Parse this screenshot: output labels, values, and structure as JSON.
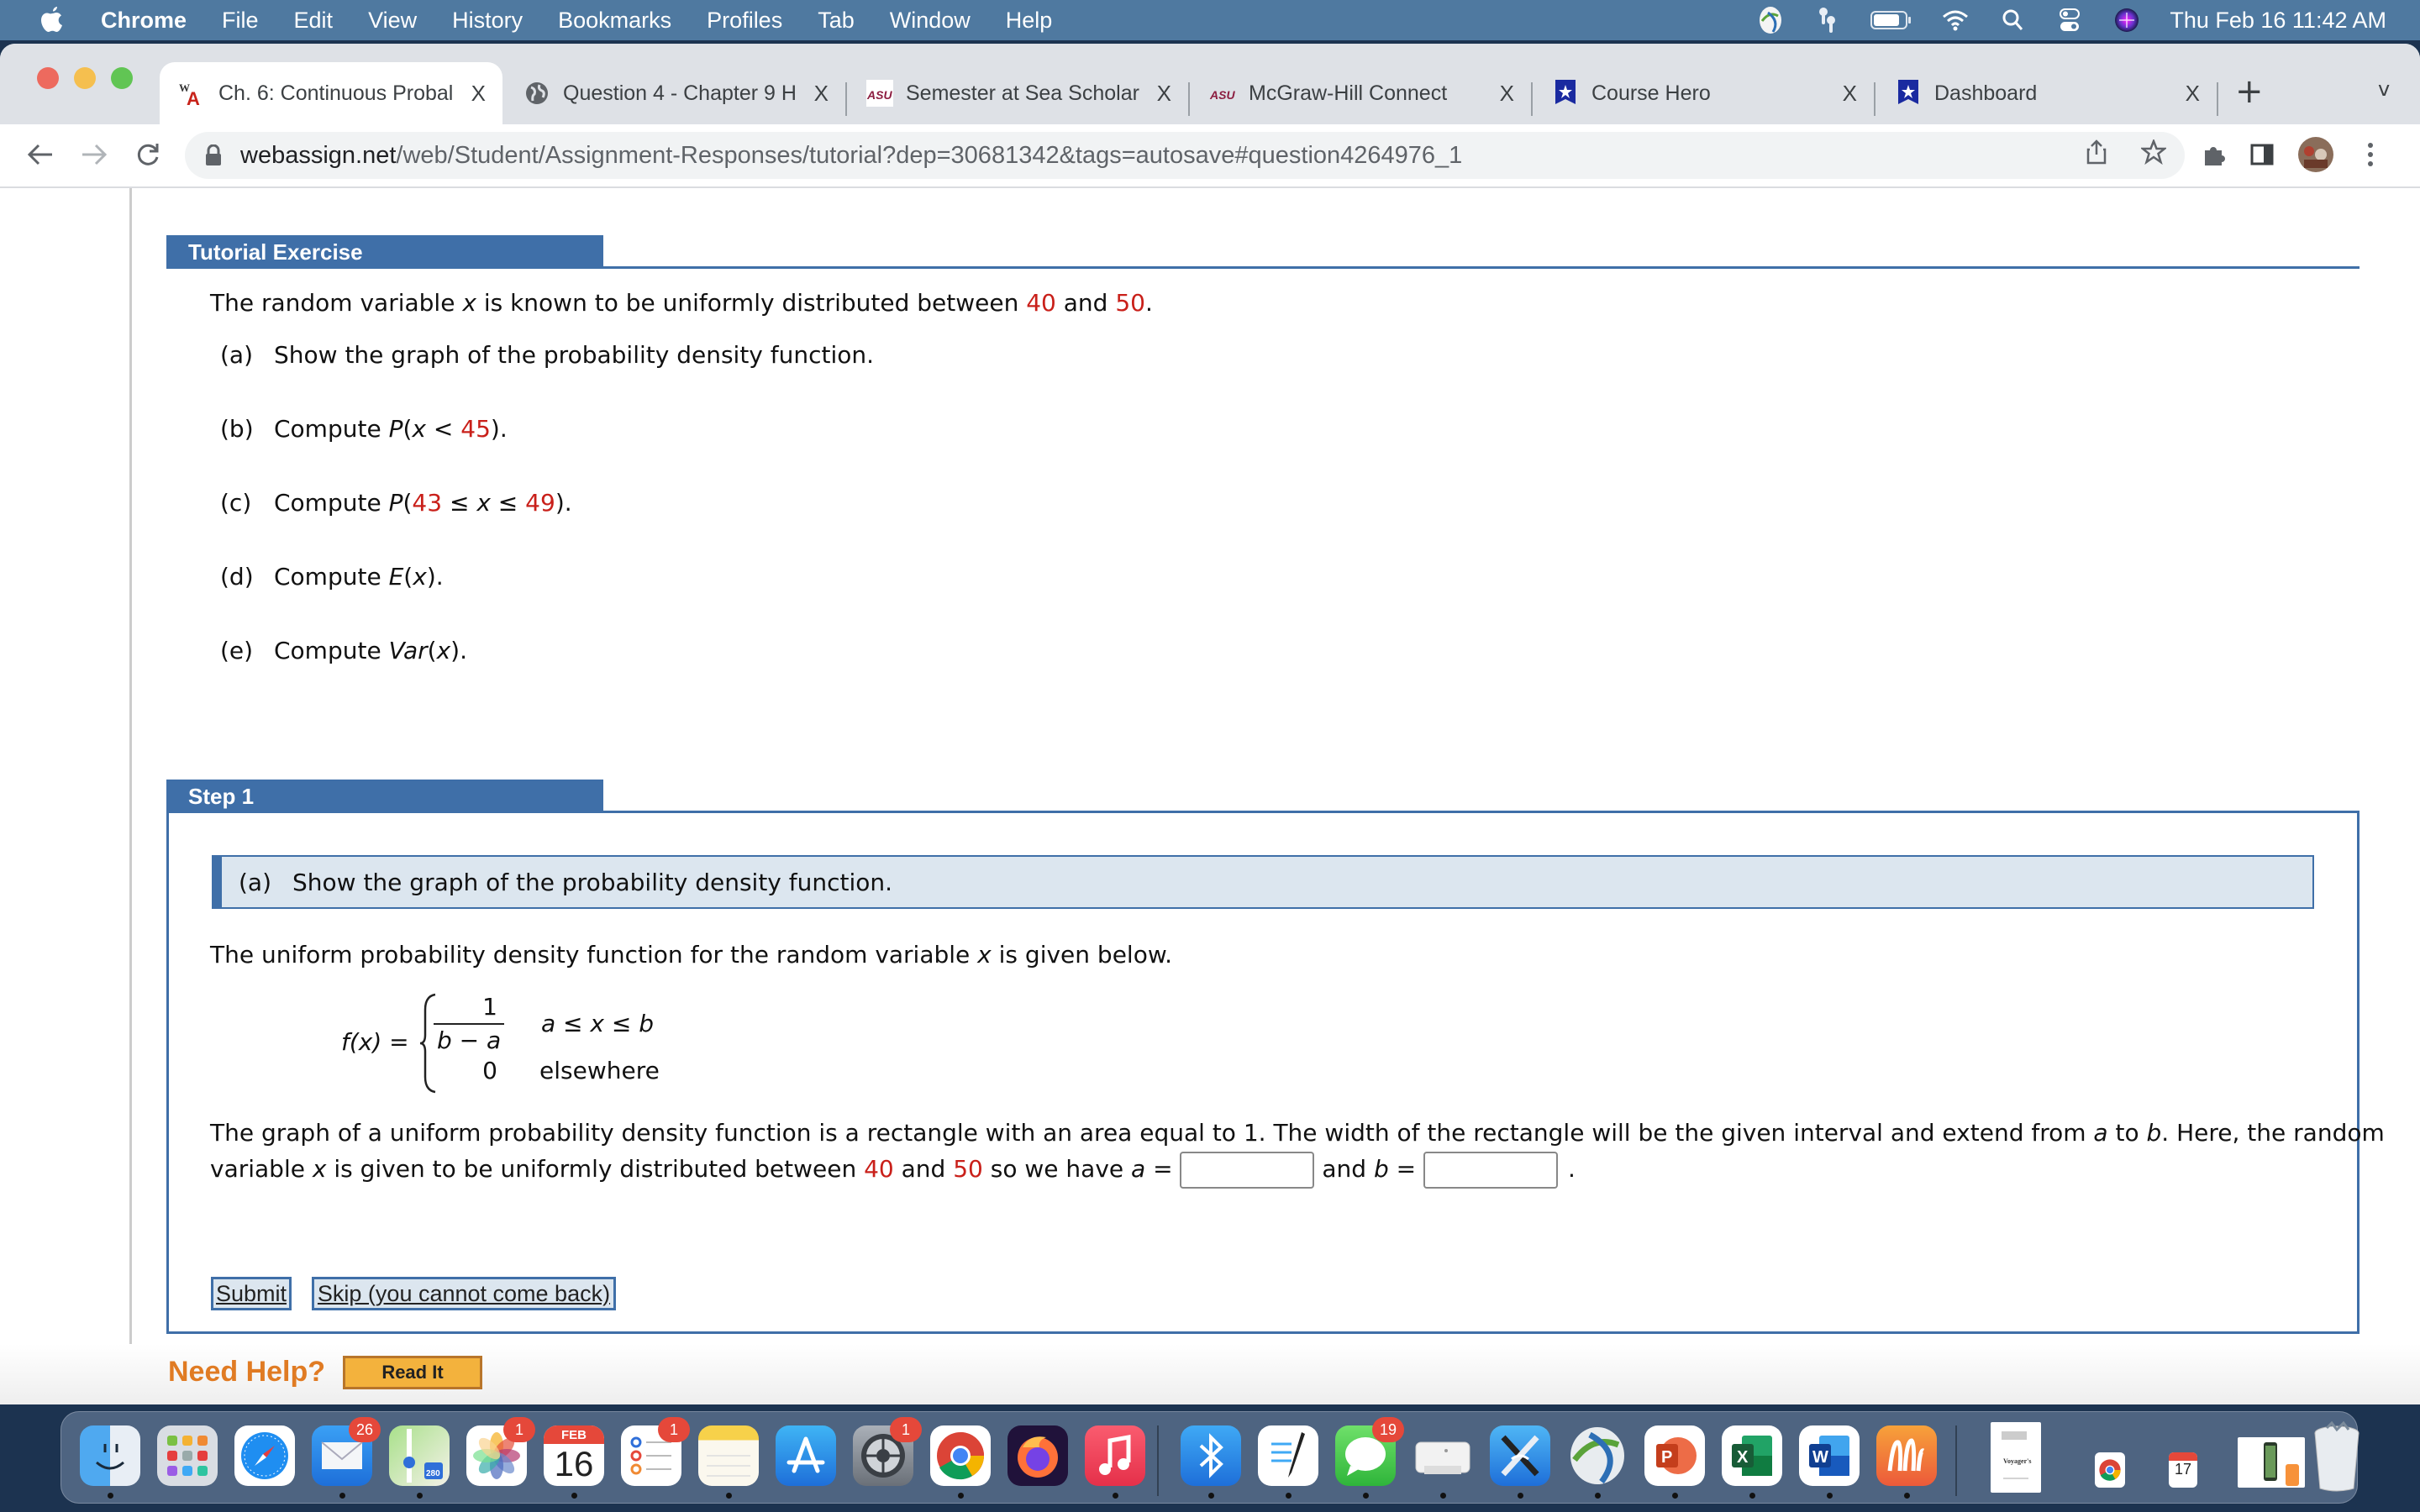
{
  "menubar": {
    "app": "Chrome",
    "items": [
      "File",
      "Edit",
      "View",
      "History",
      "Bookmarks",
      "Profiles",
      "Tab",
      "Window",
      "Help"
    ],
    "clock": "Thu Feb 16  11:42 AM",
    "status_icons": [
      "cisco-anyconnect-icon",
      "airpods-icon",
      "battery-icon",
      "wifi-icon",
      "spotlight-search-icon",
      "control-center-icon",
      "siri-icon"
    ]
  },
  "browser": {
    "tabs": [
      {
        "title": "Ch. 6: Continuous Probal",
        "favicon": "webassign-icon",
        "active": true
      },
      {
        "title": "Question 4 - Chapter 9 H",
        "favicon": "globe-icon",
        "active": false
      },
      {
        "title": "Semester at Sea Scholar",
        "favicon": "asu-icon",
        "active": false
      },
      {
        "title": "McGraw-Hill Connect",
        "favicon": "asu-icon",
        "active": false
      },
      {
        "title": "Course Hero",
        "favicon": "course-hero-icon",
        "active": false
      },
      {
        "title": "Dashboard",
        "favicon": "course-hero-icon",
        "active": false
      }
    ],
    "close_label": "X",
    "new_tab_label": "+",
    "tab_menu_label": "v",
    "url_host": "webassign.net",
    "url_path": "/web/Student/Assignment-Responses/tutorial?dep=30681342&tags=autosave#question4264976_1"
  },
  "exercise": {
    "header": "Tutorial Exercise",
    "intro": {
      "pre": "The random variable ",
      "var": "x",
      "mid": " is known to be uniformly distributed between ",
      "a": "40",
      "and": " and ",
      "b": "50",
      "end": "."
    },
    "parts": [
      {
        "label": "(a)",
        "text": "Show the graph of the probability density function."
      },
      {
        "label": "(b)",
        "pre": "Compute ",
        "fn": "P",
        "open": "(",
        "var": "x",
        "op": " < ",
        "val": "45",
        "close": ")."
      },
      {
        "label": "(c)",
        "pre": "Compute ",
        "fn": "P",
        "open": "(",
        "lo": "43",
        "op1": " ≤ ",
        "var": "x",
        "op2": " ≤ ",
        "hi": "49",
        "close": ")."
      },
      {
        "label": "(d)",
        "pre": "Compute ",
        "fn": "E",
        "open": "(",
        "var": "x",
        "close": ")."
      },
      {
        "label": "(e)",
        "pre": "Compute ",
        "fn": "Var",
        "open": "(",
        "var": "x",
        "close": ")."
      }
    ]
  },
  "step": {
    "header": "Step 1",
    "part_label": "(a)",
    "part_text": "Show the graph of the probability density function.",
    "pdf_intro": {
      "pre": "The uniform probability density function for the random variable ",
      "var": "x",
      "post": " is given below."
    },
    "formula": {
      "lhs": "f(x) =",
      "numerator": "1",
      "denominator": "b − a",
      "case1_condition": "a ≤ x ≤ b",
      "case2_value": "0",
      "case2_condition": "elsewhere"
    },
    "explain_line1": {
      "pre": "The graph of a uniform probability density function is a rectangle with an area equal to 1. The width of the rectangle will be the given interval and extend from ",
      "a": "a",
      "to": " to ",
      "b": "b",
      "post": ". Here, the random"
    },
    "explain_line2": {
      "pre": "variable ",
      "var": "x",
      "mid": " is given to be uniformly distributed between ",
      "lo": "40",
      "and": " and ",
      "hi": "50",
      "so": " so we have ",
      "a": "a",
      "eq1": " = ",
      "and2": " and ",
      "b": "b",
      "eq2": " = ",
      "end": "."
    },
    "inputs": {
      "a_value": "",
      "b_value": ""
    },
    "submit_label": "Submit",
    "skip_label": "Skip (you cannot come back)"
  },
  "help": {
    "label": "Need Help?",
    "read_it_label": "Read It"
  },
  "dock": {
    "apps": [
      {
        "name": "finder",
        "badge": null,
        "running": true
      },
      {
        "name": "launchpad",
        "badge": null,
        "running": false
      },
      {
        "name": "safari",
        "badge": null,
        "running": false
      },
      {
        "name": "mail",
        "badge": "26",
        "running": true
      },
      {
        "name": "maps",
        "badge": null,
        "running": true
      },
      {
        "name": "photos",
        "badge": "1",
        "running": false
      },
      {
        "name": "calendar",
        "badge": null,
        "running": true,
        "month": "FEB",
        "day": "16"
      },
      {
        "name": "reminders",
        "badge": "1",
        "running": false
      },
      {
        "name": "notes",
        "badge": null,
        "running": true
      },
      {
        "name": "app-store",
        "badge": null,
        "running": false
      },
      {
        "name": "system-preferences",
        "badge": "1",
        "running": false
      },
      {
        "name": "chrome",
        "badge": null,
        "running": true
      },
      {
        "name": "firefox",
        "badge": null,
        "running": false
      },
      {
        "name": "music",
        "badge": null,
        "running": true
      },
      {
        "name": "bluetooth-file-exchange",
        "badge": null,
        "running": true
      },
      {
        "name": "textedit",
        "badge": null,
        "running": true
      },
      {
        "name": "messages",
        "badge": "19",
        "running": true
      },
      {
        "name": "printer",
        "badge": null,
        "running": true
      },
      {
        "name": "wireless-diagnostics",
        "badge": null,
        "running": true
      },
      {
        "name": "cisco-anyconnect",
        "badge": null,
        "running": true
      },
      {
        "name": "powerpoint",
        "badge": null,
        "running": true
      },
      {
        "name": "excel",
        "badge": null,
        "running": true
      },
      {
        "name": "word",
        "badge": null,
        "running": true
      },
      {
        "name": "music-memos",
        "badge": null,
        "running": true
      }
    ],
    "stack_items": [
      "voyagers-handbook-document",
      "chrome-download",
      "calendar-17",
      "photo-stack",
      "trash"
    ],
    "calendar_small_day": "17",
    "letter_p": "P",
    "letter_x": "X",
    "letter_w": "W"
  }
}
